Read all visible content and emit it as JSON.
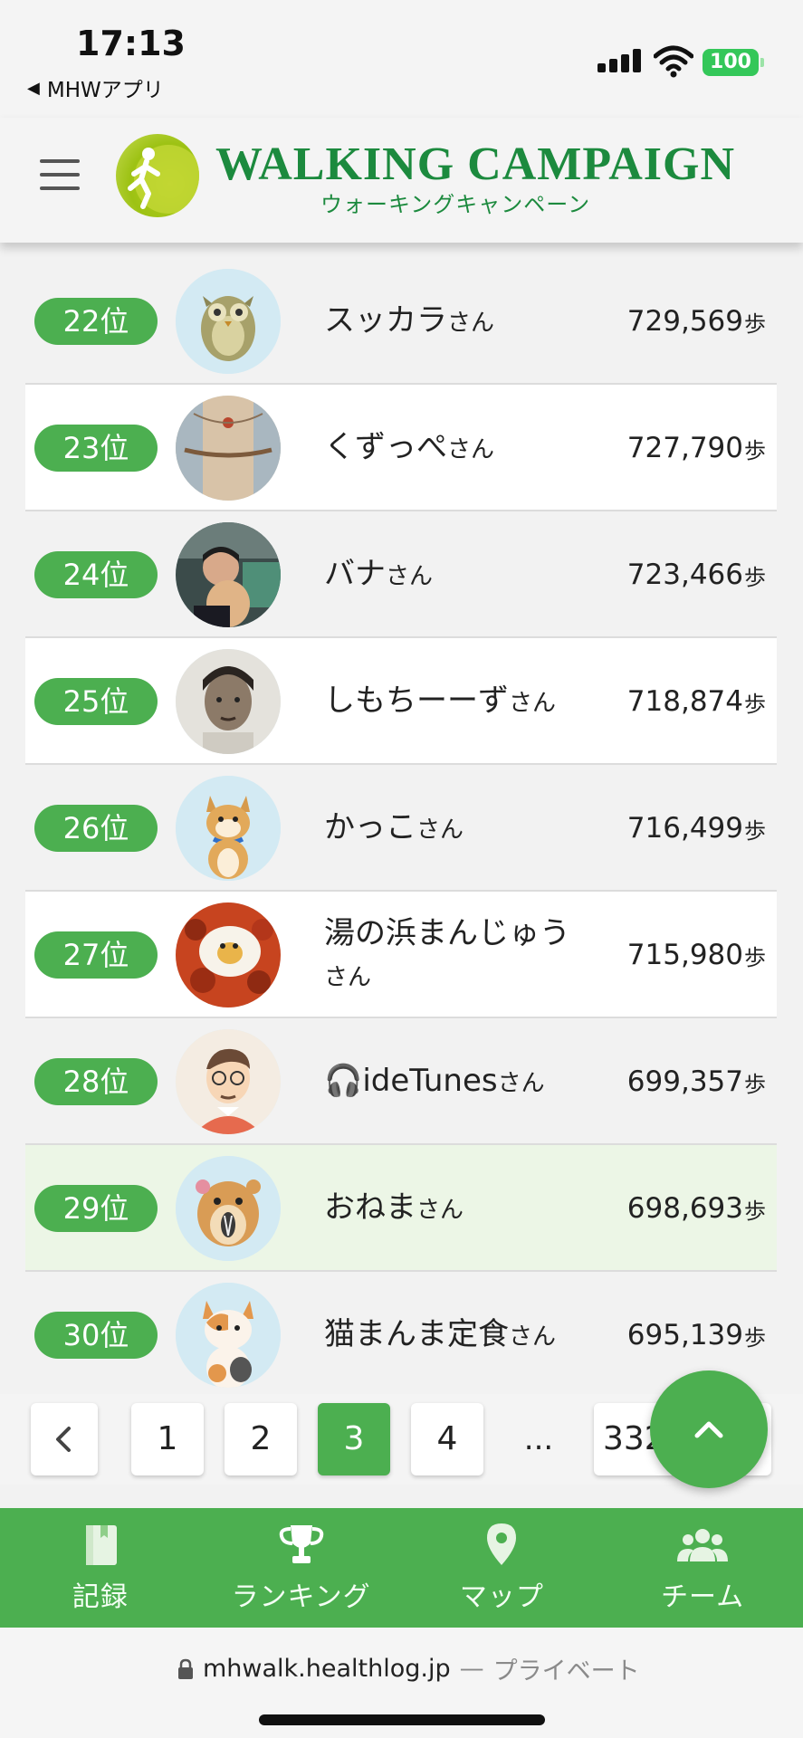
{
  "status_bar": {
    "time": "17:13",
    "back_app": "MHWアプリ",
    "battery": "100"
  },
  "header": {
    "title": "WALKING CAMPAIGN",
    "subtitle": "ウォーキングキャンペーン",
    "menu_icon": "hamburger-icon"
  },
  "ranking": [
    {
      "rank": "22位",
      "name": "スッカラ",
      "suffix": "さん",
      "steps": "729,569",
      "unit": "歩",
      "avatar": "owl"
    },
    {
      "rank": "23位",
      "name": "くずっぺ",
      "suffix": "さん",
      "steps": "727,790",
      "unit": "歩",
      "avatar": "doll"
    },
    {
      "rank": "24位",
      "name": "バナ",
      "suffix": "さん",
      "steps": "723,466",
      "unit": "歩",
      "avatar": "photo-person"
    },
    {
      "rank": "25位",
      "name": "しもちーーず",
      "suffix": "さん",
      "steps": "718,874",
      "unit": "歩",
      "avatar": "photo-portrait"
    },
    {
      "rank": "26位",
      "name": "かっこ",
      "suffix": "さん",
      "steps": "716,499",
      "unit": "歩",
      "avatar": "shiba-dog"
    },
    {
      "rank": "27位",
      "name": "湯の浜まんじゅう",
      "suffix": "さん",
      "steps": "715,980",
      "unit": "歩",
      "avatar": "food"
    },
    {
      "rank": "28位",
      "name": "🎧ideTunes",
      "suffix": "さん",
      "steps": "699,357",
      "unit": "歩",
      "avatar": "man-glasses"
    },
    {
      "rank": "29位",
      "name": "おねま",
      "suffix": "さん",
      "steps": "698,693",
      "unit": "歩",
      "avatar": "hamster",
      "highlight": true
    },
    {
      "rank": "30位",
      "name": "猫まんま定食",
      "suffix": "さん",
      "steps": "695,139",
      "unit": "歩",
      "avatar": "cat"
    }
  ],
  "pagination": {
    "prev": "<",
    "pages": [
      "1",
      "2",
      "3",
      "4"
    ],
    "current": "3",
    "ellipsis": "...",
    "last": "332"
  },
  "bottom_nav": [
    {
      "label": "記録",
      "icon": "notebook-icon"
    },
    {
      "label": "ランキング",
      "icon": "trophy-icon"
    },
    {
      "label": "マップ",
      "icon": "map-pin-icon"
    },
    {
      "label": "チーム",
      "icon": "team-icon"
    }
  ],
  "url_bar": {
    "domain": "mhwalk.healthlog.jp",
    "separator": "—",
    "privacy": "プライベート"
  },
  "colors": {
    "accent": "#4caf50",
    "brand": "#1c8a3e",
    "highlight_row": "#ecf6e6"
  }
}
